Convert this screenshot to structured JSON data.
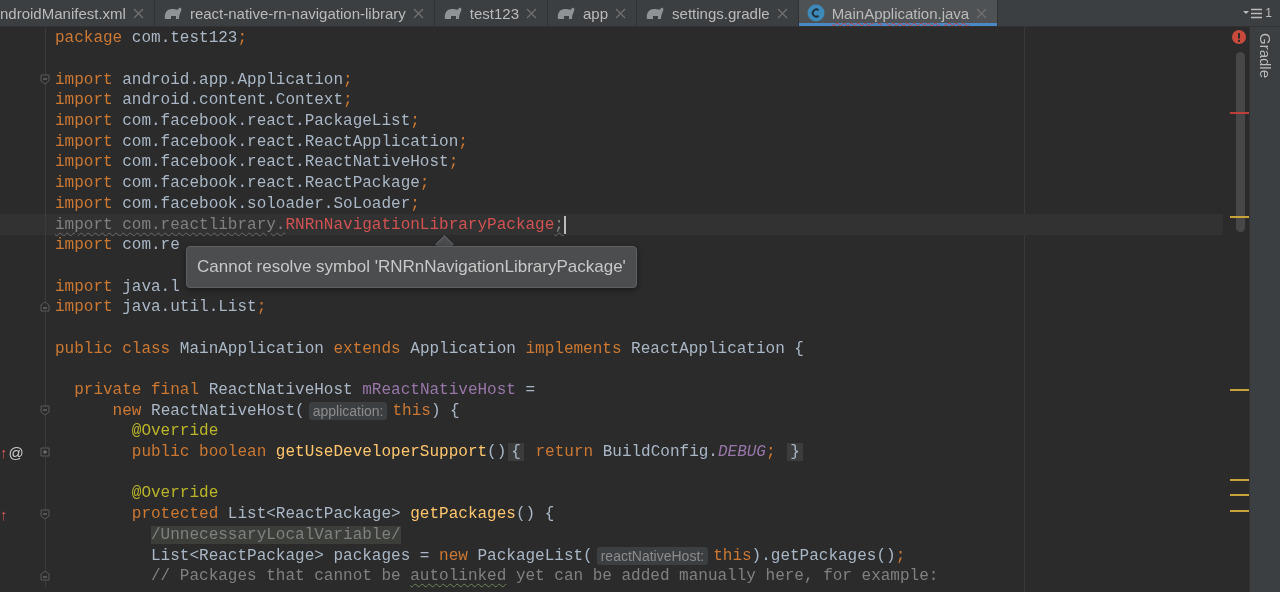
{
  "tabs": [
    {
      "label": "ndroidManifest.xml",
      "kind": "cut",
      "selected": false,
      "error": false
    },
    {
      "label": "react-native-rn-navigation-library",
      "kind": "gradle",
      "selected": false,
      "error": false
    },
    {
      "label": "test123",
      "kind": "gradle",
      "selected": false,
      "error": false
    },
    {
      "label": "app",
      "kind": "gradle",
      "selected": false,
      "error": false
    },
    {
      "label": "settings.gradle",
      "kind": "gradle",
      "selected": false,
      "error": false
    },
    {
      "label": "MainApplication.java",
      "kind": "class",
      "selected": true,
      "error": true
    }
  ],
  "tab_overflow_count": "1",
  "lines": [
    {
      "kind": "code",
      "tokens": [
        {
          "text": "package",
          "kind": "keyword"
        },
        {
          "text": " com.test123",
          "kind": "plain"
        },
        {
          "text": ";",
          "kind": "keyword"
        }
      ]
    },
    {
      "kind": "blank"
    },
    {
      "kind": "code",
      "fold_start": true,
      "tokens": [
        {
          "text": "import",
          "kind": "keyword"
        },
        {
          "text": " android.app.Application",
          "kind": "plain"
        },
        {
          "text": ";",
          "kind": "keyword"
        }
      ]
    },
    {
      "kind": "code",
      "tokens": [
        {
          "text": "import",
          "kind": "keyword"
        },
        {
          "text": " android.content.Context",
          "kind": "plain"
        },
        {
          "text": ";",
          "kind": "keyword"
        }
      ]
    },
    {
      "kind": "code",
      "tokens": [
        {
          "text": "import",
          "kind": "keyword"
        },
        {
          "text": " com.facebook.react.PackageList",
          "kind": "plain"
        },
        {
          "text": ";",
          "kind": "keyword"
        }
      ]
    },
    {
      "kind": "code",
      "tokens": [
        {
          "text": "import",
          "kind": "keyword"
        },
        {
          "text": " com.facebook.react.ReactApplication",
          "kind": "plain"
        },
        {
          "text": ";",
          "kind": "keyword"
        }
      ]
    },
    {
      "kind": "code",
      "tokens": [
        {
          "text": "import",
          "kind": "keyword"
        },
        {
          "text": " com.facebook.react.ReactNativeHost",
          "kind": "plain"
        },
        {
          "text": ";",
          "kind": "keyword"
        }
      ]
    },
    {
      "kind": "code",
      "tokens": [
        {
          "text": "import",
          "kind": "keyword"
        },
        {
          "text": " com.facebook.react.ReactPackage",
          "kind": "plain"
        },
        {
          "text": ";",
          "kind": "keyword"
        }
      ]
    },
    {
      "kind": "code",
      "tokens": [
        {
          "text": "import",
          "kind": "keyword"
        },
        {
          "text": " com.facebook.soloader.SoLoader",
          "kind": "plain"
        },
        {
          "text": ";",
          "kind": "keyword"
        }
      ]
    },
    {
      "kind": "code",
      "current": true,
      "caret": true,
      "tokens": [
        {
          "text": "import com.reactlibrary.",
          "kind": "unused"
        },
        {
          "text": "RNRnNavigationLibraryPackage",
          "kind": "error"
        },
        {
          "text": ";",
          "kind": "unused"
        }
      ]
    },
    {
      "kind": "code",
      "tokens": [
        {
          "text": "import",
          "kind": "keyword"
        },
        {
          "text": " com.re",
          "kind": "plain"
        }
      ]
    },
    {
      "kind": "blank"
    },
    {
      "kind": "code",
      "tokens": [
        {
          "text": "import",
          "kind": "keyword"
        },
        {
          "text": " java.l",
          "kind": "plain"
        }
      ]
    },
    {
      "kind": "code",
      "fold_end": true,
      "tokens": [
        {
          "text": "import",
          "kind": "keyword"
        },
        {
          "text": " java.util.List",
          "kind": "plain"
        },
        {
          "text": ";",
          "kind": "keyword"
        }
      ]
    },
    {
      "kind": "blank"
    },
    {
      "kind": "code",
      "tokens": [
        {
          "text": "public class",
          "kind": "keyword"
        },
        {
          "text": " MainApplication ",
          "kind": "plain"
        },
        {
          "text": "extends",
          "kind": "keyword"
        },
        {
          "text": " Application ",
          "kind": "plain"
        },
        {
          "text": "implements",
          "kind": "keyword"
        },
        {
          "text": " ReactApplication {",
          "kind": "plain"
        }
      ]
    },
    {
      "kind": "blank"
    },
    {
      "kind": "code",
      "tokens": [
        {
          "text": "  private final",
          "kind": "keyword"
        },
        {
          "text": " ReactNativeHost ",
          "kind": "plain"
        },
        {
          "text": "mReactNativeHost",
          "kind": "field"
        },
        {
          "text": " =",
          "kind": "plain"
        }
      ]
    },
    {
      "kind": "code",
      "fold_start": true,
      "tokens": [
        {
          "text": "      new",
          "kind": "keyword"
        },
        {
          "text": " ReactNativeHost(",
          "kind": "plain"
        },
        {
          "text": "application:",
          "kind": "hint"
        },
        {
          "text": "this",
          "kind": "keyword"
        },
        {
          "text": ") {",
          "kind": "plain"
        }
      ]
    },
    {
      "kind": "code",
      "tokens": [
        {
          "text": "        @Override",
          "kind": "annotation"
        }
      ]
    },
    {
      "kind": "code",
      "collapsed": true,
      "gutter": [
        {
          "text": "↑",
          "kind": "override"
        },
        {
          "text": "@",
          "kind": "annotated"
        }
      ],
      "tokens": [
        {
          "text": "        public boolean ",
          "kind": "keyword"
        },
        {
          "text": "getUseDeveloperSupport",
          "kind": "method"
        },
        {
          "text": "()",
          "kind": "plain"
        },
        {
          "text": "{",
          "kind": "folded"
        },
        {
          "text": " return",
          "kind": "keyword"
        },
        {
          "text": " BuildConfig.",
          "kind": "plain"
        },
        {
          "text": "DEBUG",
          "kind": "constant"
        },
        {
          "text": "; ",
          "kind": "keyword"
        },
        {
          "text": "}",
          "kind": "folded"
        }
      ]
    },
    {
      "kind": "blank"
    },
    {
      "kind": "code",
      "tokens": [
        {
          "text": "        @Override",
          "kind": "annotation"
        }
      ]
    },
    {
      "kind": "code",
      "fold_start": true,
      "gutter": [
        {
          "text": "↑",
          "kind": "override"
        }
      ],
      "tokens": [
        {
          "text": "        protected",
          "kind": "keyword"
        },
        {
          "text": " List<ReactPackage> ",
          "kind": "plain"
        },
        {
          "text": "getPackages",
          "kind": "method"
        },
        {
          "text": "() {",
          "kind": "plain"
        }
      ]
    },
    {
      "kind": "code",
      "tokens": [
        {
          "text": "          /UnnecessaryLocalVariable/",
          "kind": "suppressed"
        }
      ]
    },
    {
      "kind": "code",
      "tokens": [
        {
          "text": "          List<ReactPackage> packages = ",
          "kind": "plain"
        },
        {
          "text": "new",
          "kind": "keyword"
        },
        {
          "text": " PackageList(",
          "kind": "plain"
        },
        {
          "text": "reactNativeHost:",
          "kind": "hint"
        },
        {
          "text": "this",
          "kind": "keyword"
        },
        {
          "text": ").getPackages()",
          "kind": "plain"
        },
        {
          "text": ";",
          "kind": "keyword"
        }
      ]
    },
    {
      "kind": "code",
      "fold_end": true,
      "tokens": [
        {
          "text": "          // Packages that cannot be ",
          "kind": "comment"
        },
        {
          "text": "autolinked",
          "kind": "typo"
        },
        {
          "text": " yet can be added manually here, for example:",
          "kind": "comment"
        }
      ]
    }
  ],
  "tooltip": {
    "text": "Cannot resolve symbol 'RNRnNavigationLibraryPackage'"
  },
  "tool_window": {
    "label": "Gradle"
  }
}
